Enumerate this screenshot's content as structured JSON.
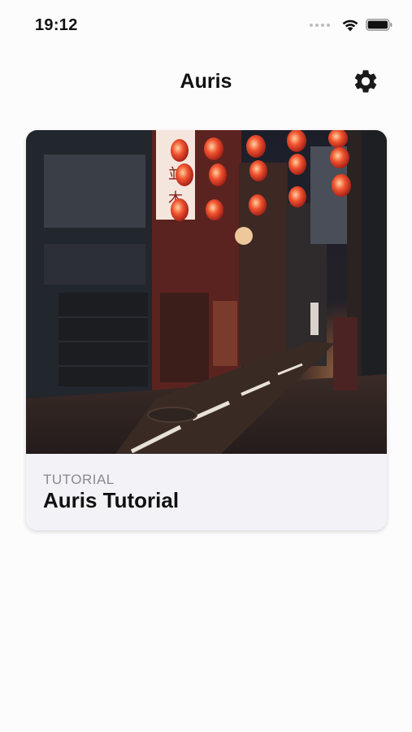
{
  "status_bar": {
    "time": "19:12"
  },
  "nav": {
    "title": "Auris",
    "settings_icon": "gear-icon"
  },
  "card": {
    "kicker": "TUTORIAL",
    "title": "Auris Tutorial",
    "image_description_icon": "photo-night-alley-lanterns"
  },
  "colors": {
    "background": "#fdfcfd",
    "card_footer": "#f2f2f7",
    "kicker_gray": "#8a8a8e",
    "lantern_red": "#e8412a"
  }
}
